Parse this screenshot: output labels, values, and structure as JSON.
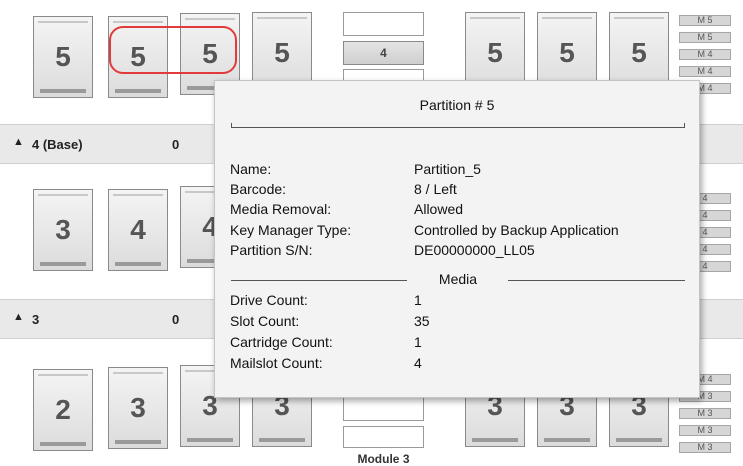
{
  "modules": {
    "top": {
      "magazines": [
        "5",
        "5",
        "5",
        "5",
        "5",
        "5",
        "5"
      ],
      "drive_center": "4",
      "mailslots": [
        "M 5",
        "M 5",
        "M 4",
        "M 4",
        "M 4"
      ]
    },
    "middle": {
      "magazines": [
        "3",
        "4",
        "4"
      ],
      "mailslots": [
        "4",
        "4",
        "4",
        "4",
        "4"
      ]
    },
    "bottom": {
      "magazines": [
        "2",
        "3",
        "3",
        "3",
        "3",
        "3",
        "3"
      ],
      "mailslots": [
        "M 4",
        "M 3",
        "M 3",
        "M 3",
        "M 3"
      ],
      "label": "Module 3"
    }
  },
  "headers": [
    {
      "caret": "▲",
      "title": "4 (Base)",
      "count": "0"
    },
    {
      "caret": "▲",
      "title": "3",
      "count": "0"
    }
  ],
  "tooltip": {
    "title": "Partition # 5",
    "rows": [
      {
        "label": "Name:",
        "value": "Partition_5"
      },
      {
        "label": "Barcode:",
        "value": "8 / Left"
      },
      {
        "label": "Media Removal:",
        "value": "Allowed"
      },
      {
        "label": "Key Manager Type:",
        "value": "Controlled by Backup Application"
      },
      {
        "label": "Partition S/N:",
        "value": "DE00000000_LL05"
      }
    ],
    "media_label": "Media",
    "media_rows": [
      {
        "label": "Drive Count:",
        "value": "1"
      },
      {
        "label": "Slot Count:",
        "value": "35"
      },
      {
        "label": "Cartridge Count:",
        "value": "1"
      },
      {
        "label": "Mailslot Count:",
        "value": "4"
      }
    ]
  },
  "colors": {
    "highlight": "#e23b3b",
    "header_bg": "#e9e9e9",
    "tooltip_bg": "#f3f3f3"
  }
}
